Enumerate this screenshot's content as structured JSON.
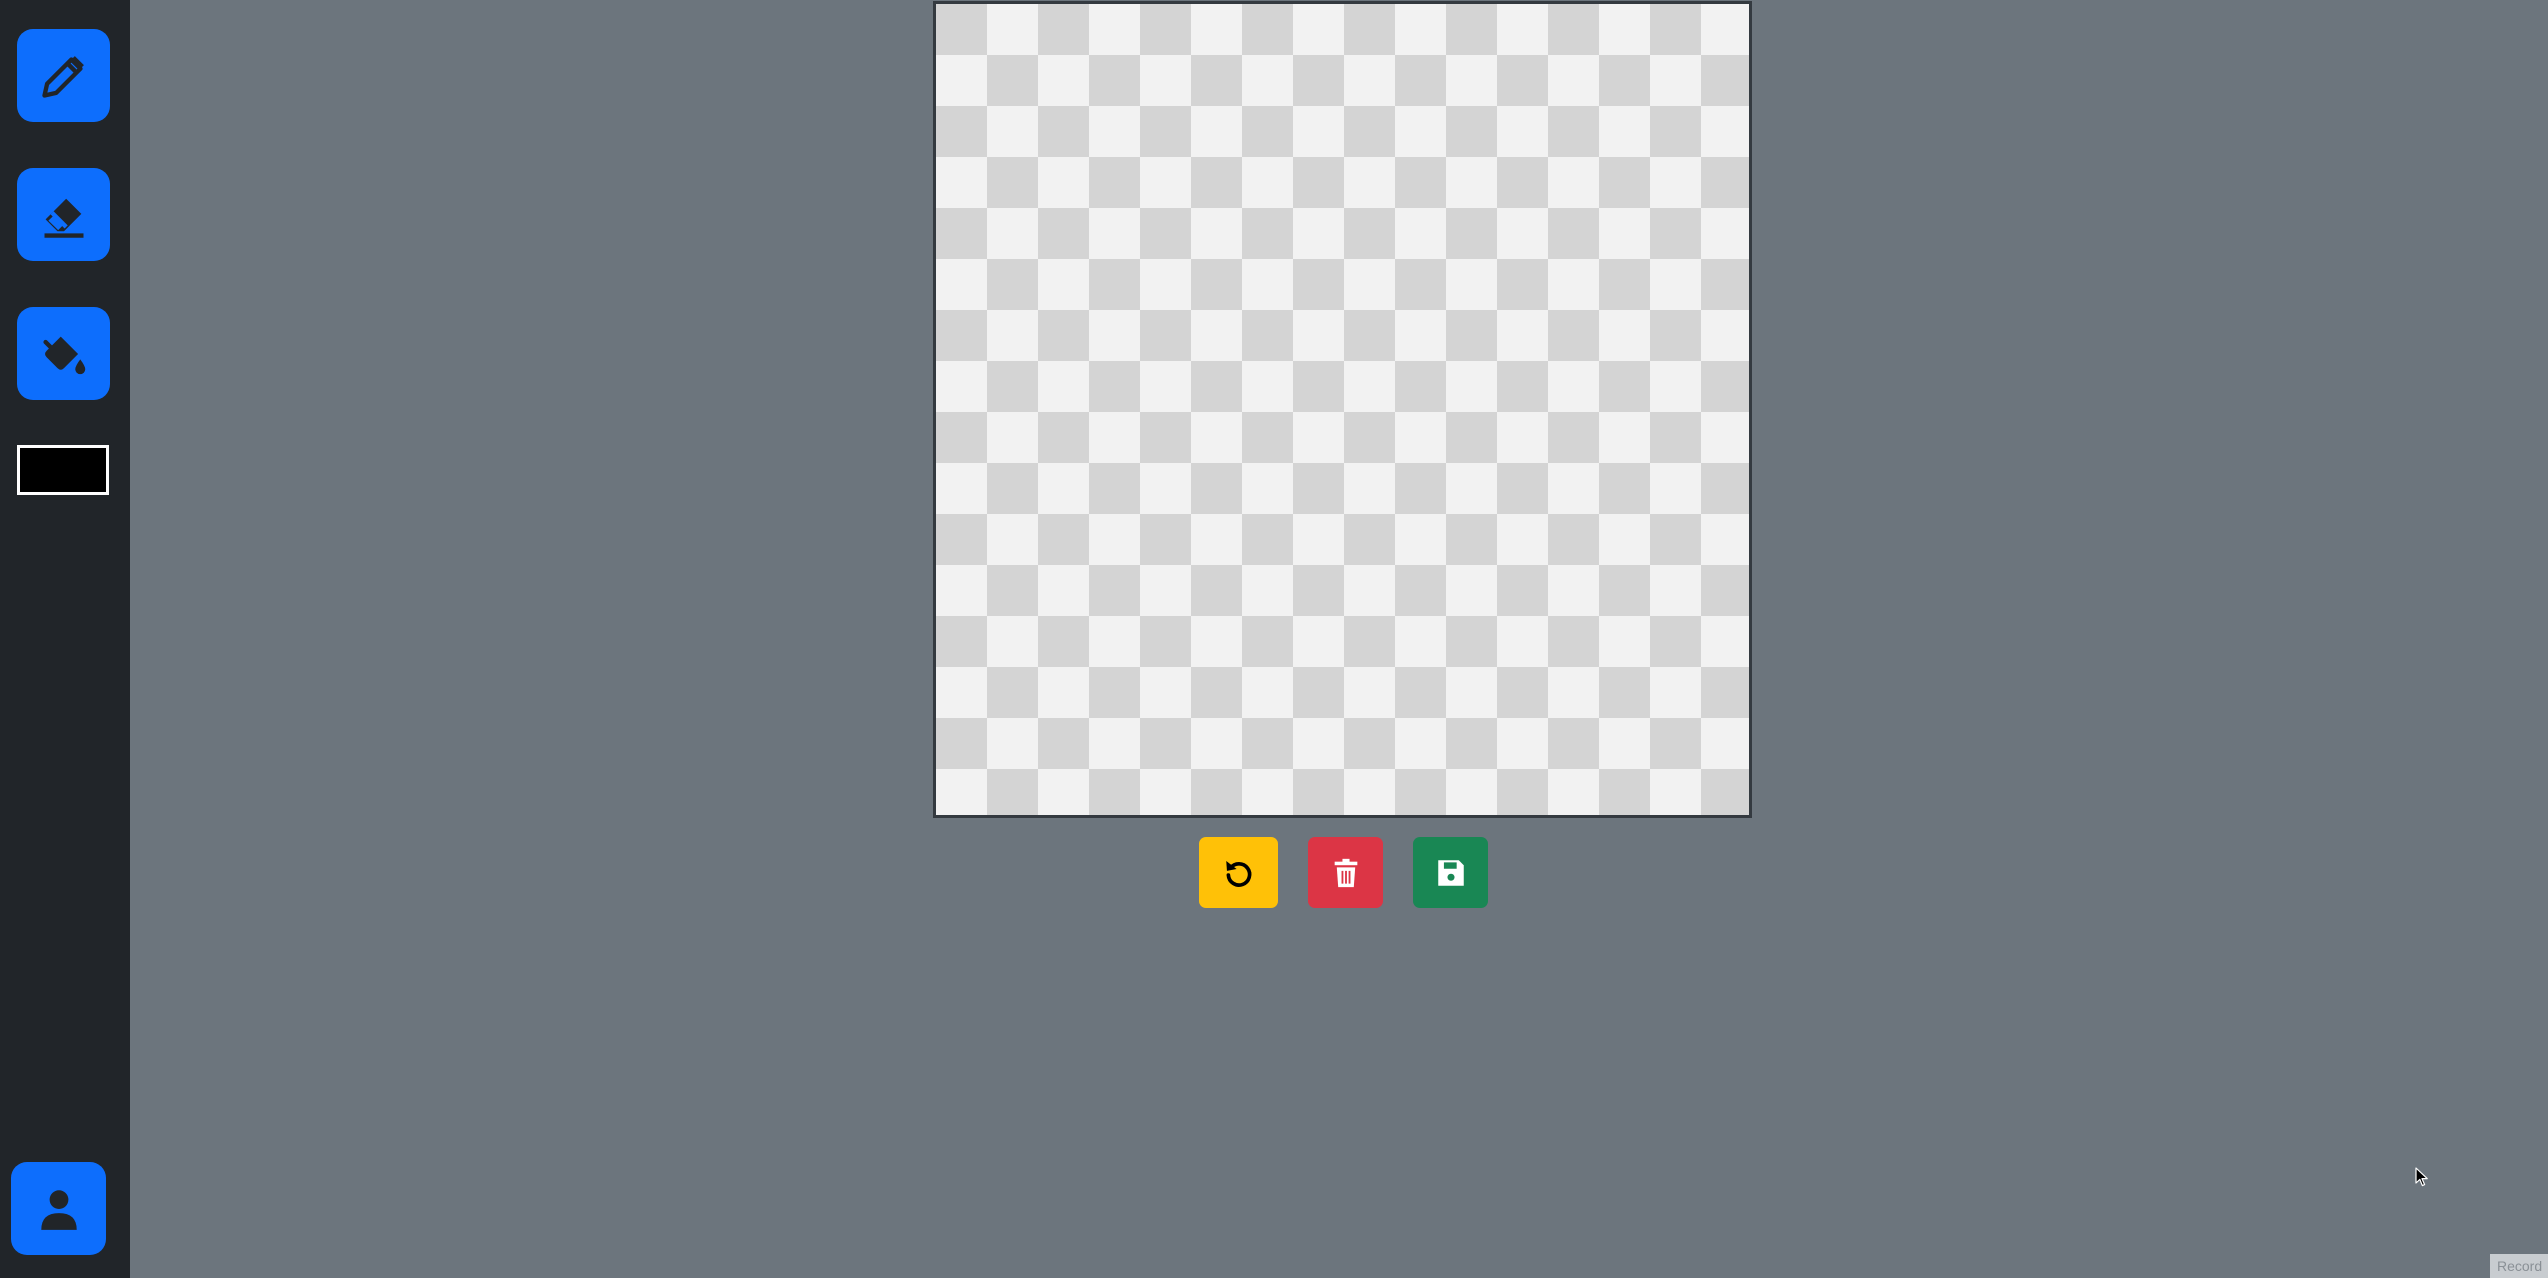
{
  "sidebar": {
    "tools": [
      {
        "name": "pencil",
        "icon": "pencil-icon"
      },
      {
        "name": "eraser",
        "icon": "eraser-icon"
      },
      {
        "name": "fill",
        "icon": "paint-bucket-icon"
      }
    ],
    "current_color": "#000000",
    "profile_icon": "person-icon"
  },
  "actions": [
    {
      "name": "undo",
      "icon": "undo-icon",
      "color": "#ffc107"
    },
    {
      "name": "clear",
      "icon": "trash-icon",
      "color": "#dc3545"
    },
    {
      "name": "save",
      "icon": "floppy-disk-icon",
      "color": "#198754"
    }
  ],
  "colors": {
    "background": "#6c757d",
    "sidebar": "#212529",
    "tool_accent": "#0d6efd"
  },
  "footer": {
    "record_label": "Record"
  }
}
